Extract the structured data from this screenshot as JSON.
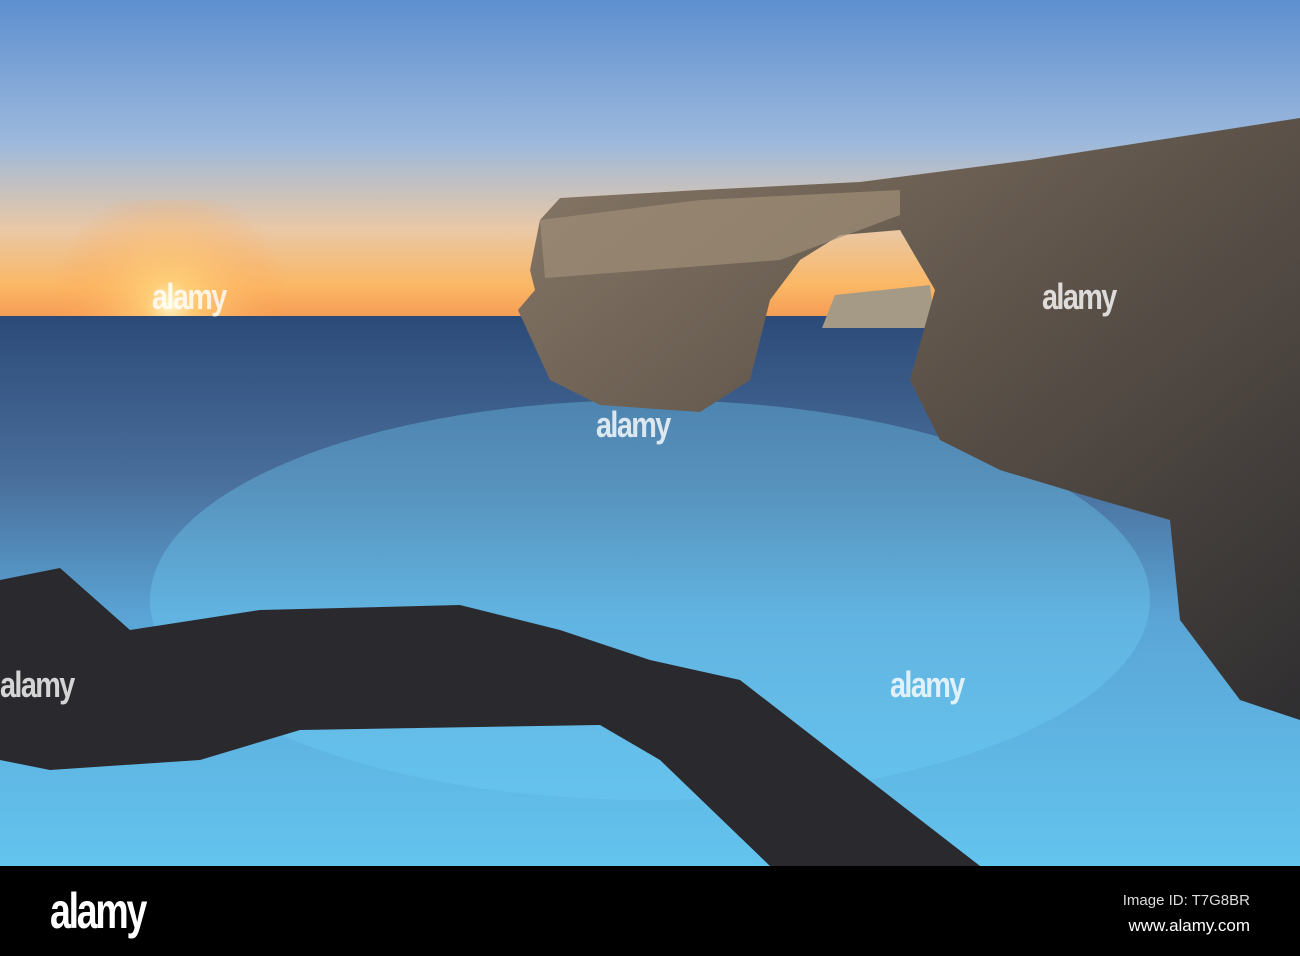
{
  "image": {
    "subject": "sea arch at sunset with long-exposure water"
  },
  "watermark": {
    "text": "alamy"
  },
  "footer": {
    "logo": "alamy",
    "image_id": "Image ID: T7G8BR",
    "url": "www.alamy.com"
  }
}
